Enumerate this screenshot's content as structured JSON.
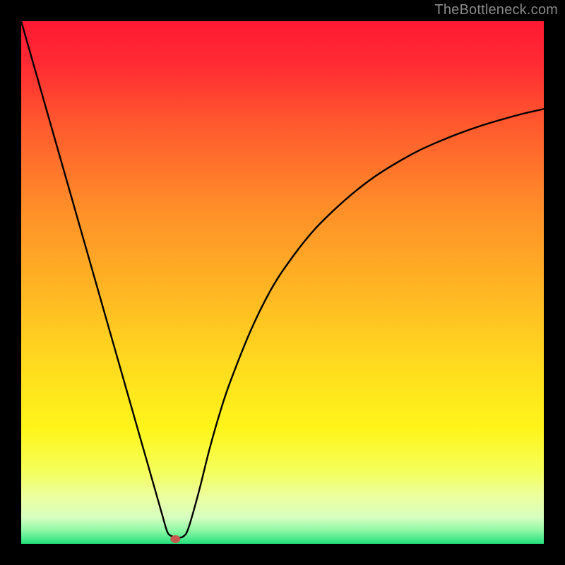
{
  "watermark": "TheBottleneck.com",
  "chart_data": {
    "type": "line",
    "title": "",
    "xlabel": "",
    "ylabel": "",
    "xlim": [
      0,
      100
    ],
    "ylim": [
      0,
      100
    ],
    "series": [
      {
        "name": "bottleneck-curve",
        "x": [
          0,
          2,
          4,
          6,
          8,
          10,
          12,
          14,
          16,
          18,
          20,
          22,
          24,
          26,
          27,
          28,
          29,
          30,
          31,
          32,
          34,
          36,
          38,
          40,
          44,
          48,
          52,
          56,
          60,
          64,
          68,
          72,
          76,
          80,
          84,
          88,
          92,
          96,
          100
        ],
        "y": [
          100,
          93,
          86,
          79,
          72,
          65,
          58,
          51,
          44,
          37,
          30,
          23,
          16,
          9,
          5.5,
          2.2,
          1.4,
          1.2,
          1.4,
          3,
          10,
          18,
          25,
          31,
          41,
          49,
          55,
          60,
          64,
          67.5,
          70.5,
          73,
          75.2,
          77,
          78.6,
          80,
          81.2,
          82.3,
          83.2
        ]
      }
    ],
    "marker": {
      "x": 29.5,
      "y": 0.9
    },
    "gradient_stops": [
      {
        "offset": 0,
        "color": "#ff1a33"
      },
      {
        "offset": 0.08,
        "color": "#ff2a33"
      },
      {
        "offset": 0.2,
        "color": "#ff5a2e"
      },
      {
        "offset": 0.35,
        "color": "#ff8c29"
      },
      {
        "offset": 0.5,
        "color": "#ffb224"
      },
      {
        "offset": 0.65,
        "color": "#ffd91f"
      },
      {
        "offset": 0.78,
        "color": "#fff51a"
      },
      {
        "offset": 0.86,
        "color": "#f5ff5a"
      },
      {
        "offset": 0.91,
        "color": "#ecffa0"
      },
      {
        "offset": 0.95,
        "color": "#d6ffc0"
      },
      {
        "offset": 0.975,
        "color": "#8cf7a5"
      },
      {
        "offset": 1.0,
        "color": "#23e07a"
      }
    ]
  }
}
